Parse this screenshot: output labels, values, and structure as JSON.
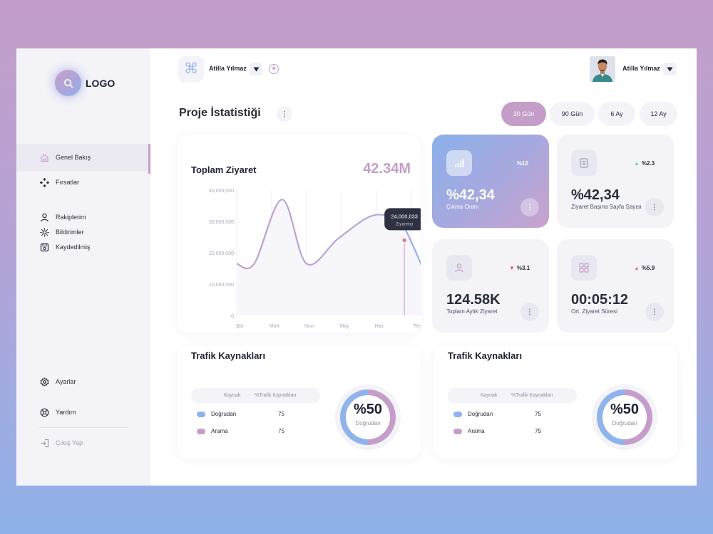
{
  "brand": {
    "logo_text": "LOGO"
  },
  "sidebar": {
    "items": [
      {
        "label": "Genel Bakış",
        "icon": "home-icon",
        "active": true
      },
      {
        "label": "Fırsatlar",
        "icon": "diamond-grid-icon"
      },
      {
        "label": "Rakiplerim",
        "icon": "user-icon"
      },
      {
        "label": "Bildirimler",
        "icon": "sun-icon"
      },
      {
        "label": "Kaydedilmiş",
        "icon": "save-icon"
      }
    ],
    "footer": [
      {
        "label": "Ayarlar",
        "icon": "gear-icon"
      },
      {
        "label": "Yardım",
        "icon": "help-icon"
      },
      {
        "label": "Çıkış Yap",
        "icon": "logout-icon"
      }
    ]
  },
  "topbar": {
    "workspace_user": "Atilla Yılmaz",
    "profile_user": "Atilla Yılmaz"
  },
  "page": {
    "title": "Proje İstatistiği",
    "ranges": [
      "30 Gün",
      "90 Gün",
      "6 Ay",
      "12 Ay"
    ],
    "active_range": "30 Gün"
  },
  "visits": {
    "title": "Toplam Ziyaret",
    "total": "42.34M",
    "tooltip": {
      "value": "24,000,033",
      "label": "Ziyaretçi"
    }
  },
  "chart_data": {
    "type": "line",
    "title": "Toplam Ziyaret",
    "categories": [
      "Şbt",
      "Mart",
      "Nisn",
      "May",
      "Haz",
      "Temmz"
    ],
    "y_ticks": [
      "40,000,000",
      "30,000,000",
      "20,000,000",
      "10,000,000",
      "0"
    ],
    "ylim": [
      0,
      40000000
    ],
    "series": [
      {
        "x": [
          0,
          0.5,
          1.3,
          2.0,
          2.9,
          3.8,
          4.4,
          4.8,
          5.5
        ],
        "values": [
          16500000,
          16500000,
          37000000,
          16500000,
          24500000,
          31500000,
          31500000,
          28000000,
          10500000
        ],
        "color": "#b6a6d8"
      }
    ],
    "highlight": {
      "x": 4.8,
      "value": 24000033
    },
    "grid": true
  },
  "stats": [
    {
      "value": "%42,34",
      "label": "Çıkma Oranı",
      "trend": "%12",
      "direction": "up",
      "icon": "signal-icon",
      "highlight": true
    },
    {
      "value": "%42,34",
      "label": "Ziyaret Başına Sayfa Sayısı",
      "trend": "%2.3",
      "direction": "up",
      "icon": "document-icon"
    },
    {
      "value": "124.58K",
      "label": "Toplam Aylık Ziyaret",
      "trend": "%3.1",
      "direction": "down",
      "icon": "user-icon"
    },
    {
      "value": "00:05:12",
      "label": "Ort. Ziyaret Süresi",
      "trend": "%5.9",
      "direction": "up",
      "icon": "grid-icon"
    }
  ],
  "traffic": [
    {
      "title": "Trafik Kaynakları",
      "headers": [
        "Kaynak",
        "%Trafik Kaynakları"
      ],
      "rows": [
        {
          "label": "Doğrudan",
          "value": "75"
        },
        {
          "label": "Arama",
          "value": "75"
        }
      ],
      "donut_value": "%50",
      "donut_label": "Doğrudan",
      "donut_fraction": 0.5
    },
    {
      "title": "Trafik Kaynakları",
      "headers": [
        "Kaynak",
        "%Trafik Kaynakları"
      ],
      "rows": [
        {
          "label": "Doğrudan",
          "value": "75"
        },
        {
          "label": "Arama",
          "value": "75"
        }
      ],
      "donut_value": "%50",
      "donut_label": "Doğrudan",
      "donut_fraction": 0.5
    }
  ],
  "colors": {
    "accent": "#c49ec9",
    "blue": "#8fb3ea",
    "trend_up": "#6ccbb4",
    "trend_down": "#e0566b",
    "trend_up_alt": "#e87c8c"
  }
}
